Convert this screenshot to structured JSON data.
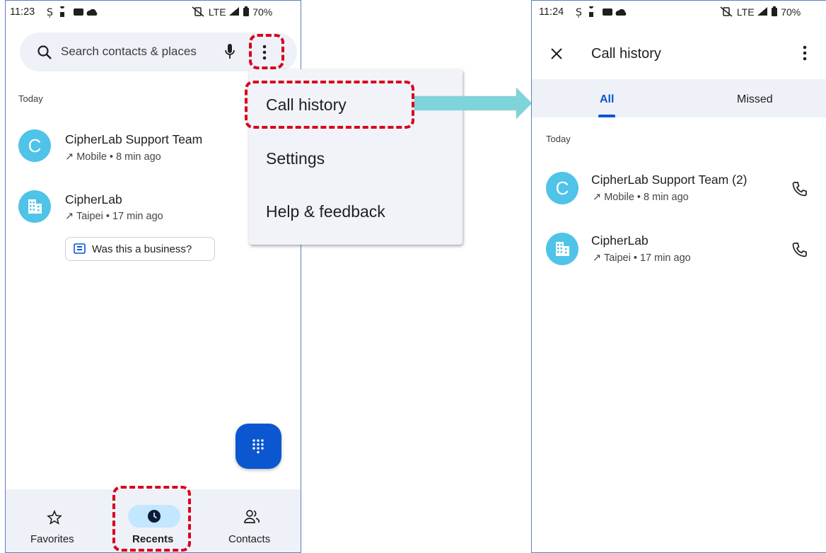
{
  "left_screen": {
    "status_bar": {
      "time": "11:23",
      "network": "LTE",
      "battery": "70%"
    },
    "search": {
      "placeholder": "Search contacts & places"
    },
    "section_label": "Today",
    "calls": [
      {
        "name": "CipherLab Support Team",
        "detail": "Mobile • 8 min ago",
        "avatar_letter": "C",
        "direction": "↗"
      },
      {
        "name": "CipherLab",
        "detail": "Taipei • 17 min ago",
        "avatar_icon": "building-icon",
        "direction": "↗"
      }
    ],
    "business_prompt": "Was this a business?",
    "menu": {
      "items": [
        "Call history",
        "Settings",
        "Help & feedback"
      ]
    },
    "bottom_nav": {
      "items": [
        "Favorites",
        "Recents",
        "Contacts"
      ],
      "selected": "Recents"
    }
  },
  "right_screen": {
    "status_bar": {
      "time": "11:24",
      "network": "LTE",
      "battery": "70%"
    },
    "title": "Call history",
    "tabs": [
      "All",
      "Missed"
    ],
    "selected_tab": "All",
    "section_label": "Today",
    "calls": [
      {
        "name": "CipherLab Support Team",
        "count": "(2)",
        "detail": "Mobile • 8 min ago",
        "avatar_letter": "C",
        "direction": "↗"
      },
      {
        "name": "CipherLab",
        "detail": "Taipei • 17 min ago",
        "avatar_icon": "building-icon",
        "direction": "↗"
      }
    ]
  },
  "colors": {
    "accent_blue": "#0b57d0",
    "avatar_cyan": "#4fc3e8",
    "highlight_red": "#d9001b",
    "arrow_teal": "#7fd3da",
    "surface": "#eef1f8"
  }
}
